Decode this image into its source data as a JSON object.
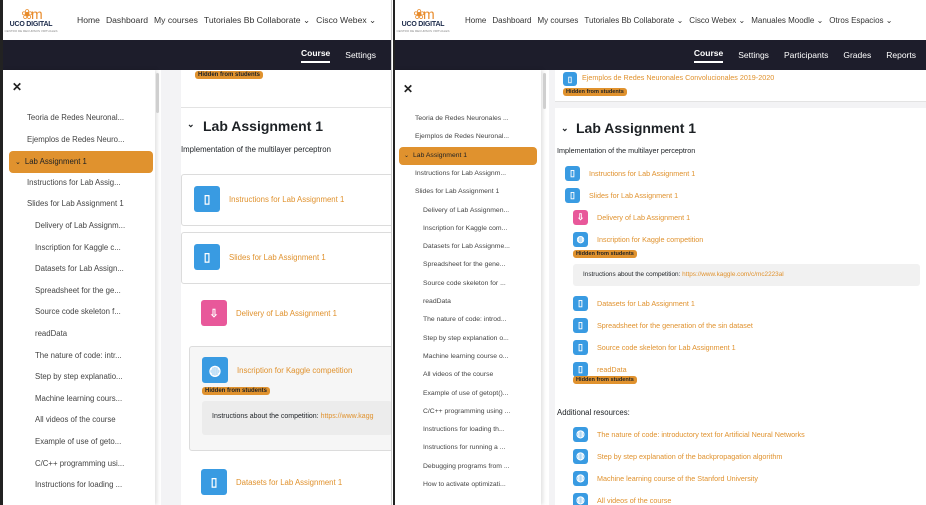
{
  "navbar": {
    "logo_text": "UCO DIGITAL",
    "logo_sub": "CENTRO DE RECURSOS VIRTUALES",
    "items_left": [
      "Home",
      "Dashboard",
      "My courses",
      "Tutoriales Bb Collaborate ⌄",
      "Cisco Webex ⌄"
    ],
    "items_right": [
      "Home",
      "Dashboard",
      "My courses",
      "Tutoriales Bb Collaborate ⌄",
      "Cisco Webex ⌄",
      "Manuales Moodle ⌄",
      "Otros Espacios ⌄"
    ]
  },
  "secondary_nav": {
    "left": [
      "Course",
      "Settings"
    ],
    "right": [
      "Course",
      "Settings",
      "Participants",
      "Grades",
      "Reports"
    ]
  },
  "drawer_left": [
    "Teoria de Redes Neuronal...",
    "Ejemplos de Redes Neuro...",
    "Lab Assignment 1",
    "Instructions for Lab Assig...",
    "Slides for Lab Assignment 1",
    "Delivery of Lab Assignm...",
    "Inscription for Kaggle c...",
    "Datasets for Lab Assign...",
    "Spreadsheet for the ge...",
    "Source code skeleton f...",
    "readData",
    "The nature of code: intr...",
    "Step by step explanatio...",
    "Machine learning cours...",
    "All videos of the course",
    "Example of use of getо...",
    "C/C++ programming usi...",
    "Instructions for loading ..."
  ],
  "drawer_right": [
    "Teoria de Redes Neuronales ...",
    "Ejemplos de Redes Neuronal...",
    "Lab Assignment 1",
    "Instructions for Lab Assignm...",
    "Slides for Lab Assignment 1",
    "Delivery of Lab Assignmen...",
    "Inscription for Kaggle com...",
    "Datasets for Lab Assignme...",
    "Spreadsheet for the gene...",
    "Source code skeleton for ...",
    "readData",
    "The nature of code: introd...",
    "Step by step explanation o...",
    "Machine learning course o...",
    "All videos of the course",
    "Example of use of getopt()...",
    "C/C++ programming using ...",
    "Instructions for loading th...",
    "Instructions for running a ...",
    "Debugging programs from ...",
    "How to activate optimizati..."
  ],
  "section": {
    "title": "Lab Assignment 1",
    "summary": "Implementation of the multilayer perceptron",
    "hidden_badge": "Hidden from students",
    "top_link": "Ejemplos de Redes Neuronales Convolucionales 2019-2020",
    "additional_resources": "Additional resources:"
  },
  "activities_left": [
    {
      "label": "Instructions for Lab Assignment 1",
      "icon": "file-icon",
      "color": "#399be2"
    },
    {
      "label": "Slides for Lab Assignment 1",
      "icon": "file-icon",
      "color": "#399be2"
    },
    {
      "label": "Delivery of Lab Assignment 1",
      "icon": "assignment-icon",
      "color": "#e8589a"
    },
    {
      "label": "Inscription for Kaggle competition",
      "icon": "globe-icon",
      "color": "#399be2"
    },
    {
      "label": "Datasets for Lab Assignment 1",
      "icon": "file-icon",
      "color": "#399be2"
    }
  ],
  "kaggle_info": {
    "left": "Instructions about the competition: ",
    "left_url": "https://www.kagg",
    "right": "Instructions about the competition: ",
    "right_url": "https://www.kaggle.com/c/mc2223al"
  },
  "activities_right": [
    {
      "label": "Instructions for Lab Assignment 1",
      "icon": "file-icon",
      "color": "#399be2"
    },
    {
      "label": "Slides for Lab Assignment 1",
      "icon": "file-icon",
      "color": "#399be2"
    },
    {
      "label": "Delivery of Lab Assignment 1",
      "icon": "assignment-icon",
      "color": "#e8589a"
    },
    {
      "label": "Inscription for Kaggle competition",
      "icon": "globe-icon",
      "color": "#399be2"
    },
    {
      "label": "Datasets for Lab Assignment 1",
      "icon": "file-icon",
      "color": "#399be2"
    },
    {
      "label": "Spreadsheet for the generation of the sin dataset",
      "icon": "file-icon",
      "color": "#399be2"
    },
    {
      "label": "Source code skeleton for Lab Assignment 1",
      "icon": "file-icon",
      "color": "#399be2"
    },
    {
      "label": "readData",
      "icon": "file-icon",
      "color": "#399be2"
    }
  ],
  "resources_right": [
    "The nature of code: introductory text for Artificial Neural Networks",
    "Step by step explanation of the backpropagation algorithm",
    "Machine learning course of the Stanford University",
    "All videos of the course"
  ],
  "colors": {
    "accent": "#e0922e",
    "dark_bar": "#1d1d2b",
    "file": "#399be2",
    "assign": "#e8589a"
  }
}
